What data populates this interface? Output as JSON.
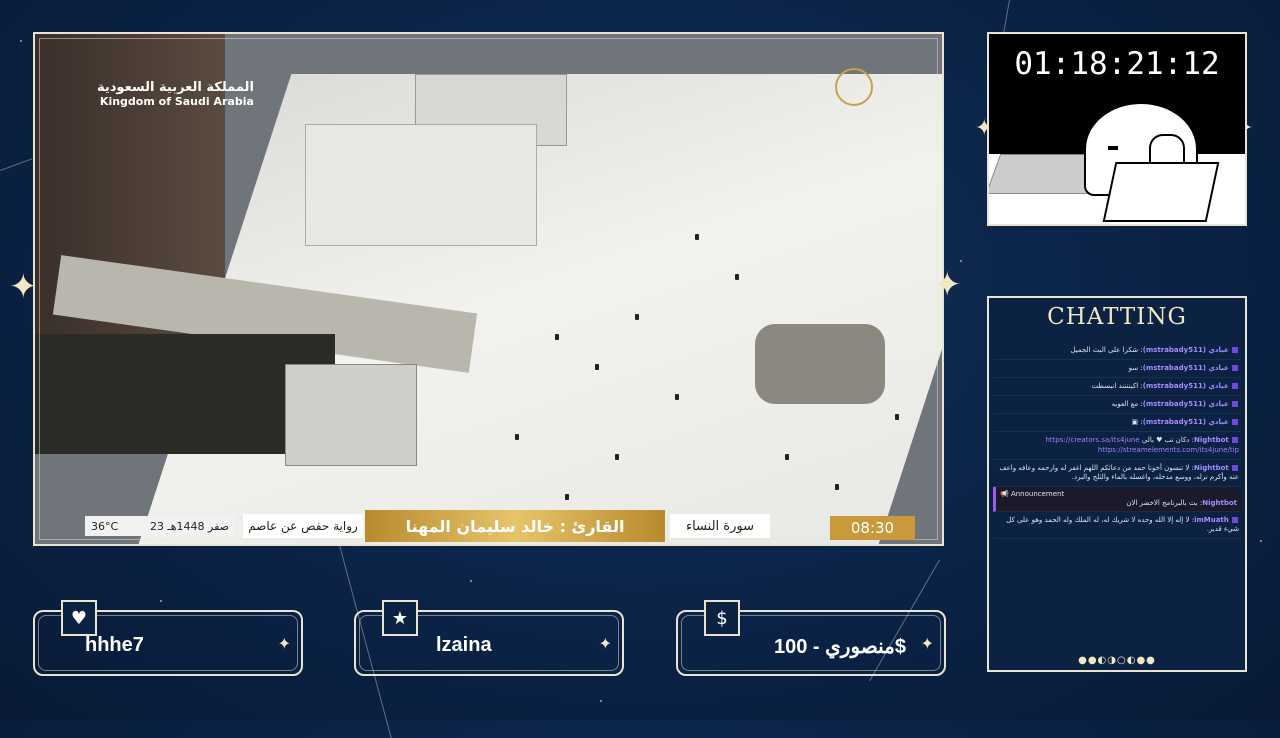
{
  "video": {
    "ksa_logo_ar": "المملكة العربية السعودية",
    "ksa_logo_en": "Kingdom of Saudi Arabia",
    "lower_third": {
      "temperature": "36°C",
      "date": "23 صفر 1448هـ",
      "riwaya": "رواية حفص عن عاصم",
      "reciter": "القارئ : خالد سليمان المهنا",
      "surah": "سورة النساء",
      "clock": "08:30"
    }
  },
  "timer": {
    "value": "01:18:21:12"
  },
  "chat": {
    "title": "CHATTING",
    "messages": [
      {
        "user": "عبادي (mstrabady511)",
        "text": "شكرا على البث الجميل"
      },
      {
        "user": "عبادي (mstrabady511)",
        "text": "سو"
      },
      {
        "user": "عبادي (mstrabady511)",
        "text": "اكينننند انبسطت"
      },
      {
        "user": "عبادي (mstrabady511)",
        "text": "مع العويه"
      },
      {
        "user": "عبادي (mstrabady511)",
        "text": ""
      },
      {
        "user": "Nightbot",
        "text": "دكان تب ♥ بالي",
        "link": "https://creators.sa/its4june https://streamelements.com/its4june/tip"
      },
      {
        "user": "Nightbot",
        "text": "لا تنسون أخونا حمد من دعائكم اللهم اغفر له وارحمه وعافه واعف عنه وأكرم نزله، ووسع مدخله، واغسله بالماء والثلج والبرد."
      }
    ],
    "announcement_label": "Announcement",
    "announcement": {
      "user": "Nightbot",
      "text": "بث بالبرنامج الاخضر الان"
    },
    "last_message": {
      "user": "imMuath",
      "text": "لا إله إلا الله وحده لا شريك له، له الملك وله الحمد وهو على كل شيء قدير."
    }
  },
  "labels": [
    {
      "icon": "heart-icon",
      "glyph": "♥",
      "text": "hhhe7"
    },
    {
      "icon": "star-icon",
      "glyph": "★",
      "text": "lzaina"
    },
    {
      "icon": "dollar-icon",
      "glyph": "$",
      "text": "منصوري - 100$"
    }
  ]
}
